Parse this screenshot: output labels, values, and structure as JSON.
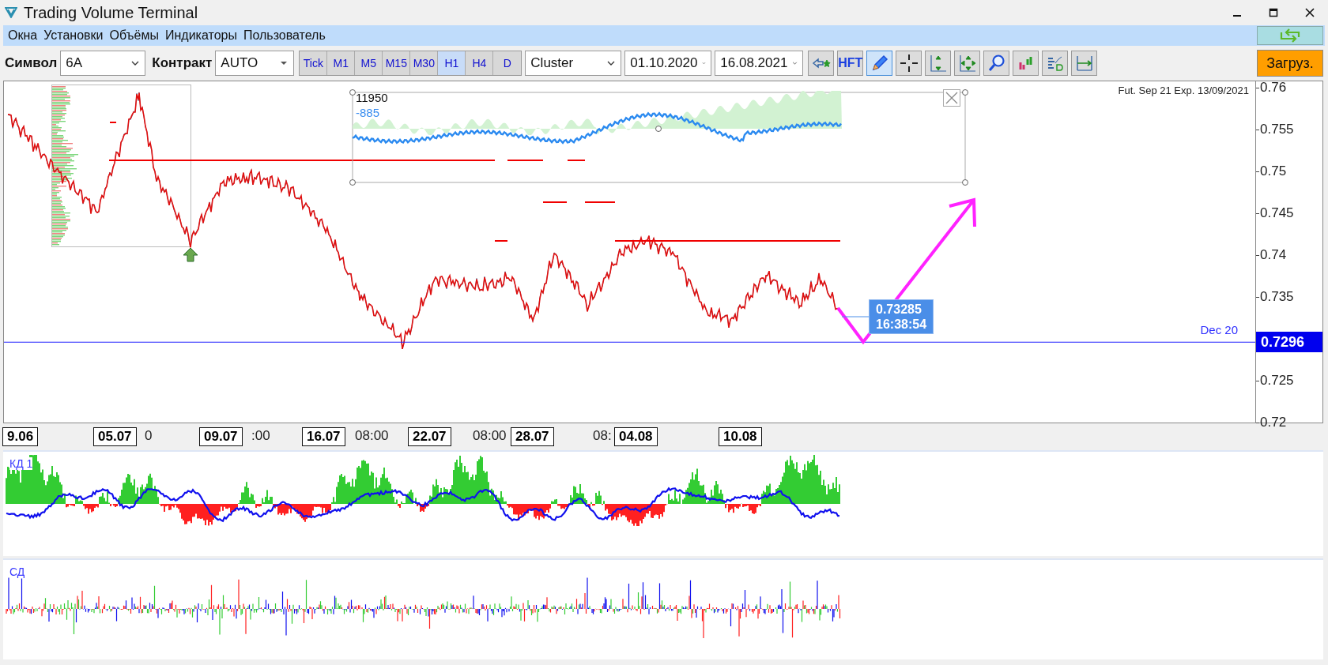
{
  "window": {
    "title": "Trading Volume Terminal"
  },
  "menu": [
    "Окна",
    "Установки",
    "Объёмы",
    "Индикаторы",
    "Пользователь"
  ],
  "toolbar": {
    "symbol_label": "Символ",
    "symbol": "6A",
    "contract_label": "Контракт",
    "contract": "AUTO",
    "timeframes": [
      {
        "label": "Tick",
        "selected": false
      },
      {
        "label": "M1",
        "selected": false
      },
      {
        "label": "M5",
        "selected": false
      },
      {
        "label": "M15",
        "selected": false
      },
      {
        "label": "M30",
        "selected": false
      },
      {
        "label": "H1",
        "selected": true
      },
      {
        "label": "H4",
        "selected": false
      },
      {
        "label": "D",
        "selected": false
      }
    ],
    "chart_type": "Cluster",
    "date_from": "01.10.2020",
    "date_to": "16.08.2021",
    "tools": [
      {
        "kind": "arrow-star",
        "selected": false
      },
      {
        "kind": "text",
        "label": "HFT",
        "selected": false
      },
      {
        "kind": "pencil",
        "selected": true
      },
      {
        "kind": "crosshair",
        "selected": false
      },
      {
        "kind": "fit-vertical",
        "selected": false
      },
      {
        "kind": "fit-all",
        "selected": false
      },
      {
        "kind": "search",
        "selected": false
      },
      {
        "kind": "bars",
        "selected": false
      },
      {
        "kind": "profile",
        "selected": false
      },
      {
        "kind": "range",
        "selected": false
      }
    ],
    "load_button": "Загруз."
  },
  "chart": {
    "contract_info": "Fut. Sep 21 Exp. 13/09/2021",
    "y_ticks": [
      "0.76",
      "0.755",
      "0.75",
      "0.745",
      "0.74",
      "0.735",
      "0.725",
      "0.72"
    ],
    "level_line": {
      "label": "Dec 20",
      "price": "0.7296"
    },
    "inset": {
      "volume": "11950",
      "delta": "-885"
    },
    "price_tag": {
      "price": "0.73285",
      "time": "16:38:54"
    },
    "x_labels": [
      {
        "text": "9.06",
        "boxed": true
      },
      {
        "text": "05.07",
        "boxed": true
      },
      {
        "text": "0",
        "boxed": false
      },
      {
        "text": "09.07",
        "boxed": true
      },
      {
        "text": ":00",
        "boxed": false
      },
      {
        "text": "16.07",
        "boxed": true
      },
      {
        "text": "08:00",
        "boxed": false
      },
      {
        "text": "22.07",
        "boxed": true
      },
      {
        "text": "08:00",
        "boxed": false
      },
      {
        "text": "28.07",
        "boxed": true
      },
      {
        "text": "08:",
        "boxed": false
      },
      {
        "text": "04.08",
        "boxed": true
      },
      {
        "text": "10.08",
        "boxed": true
      }
    ]
  },
  "panels": [
    {
      "kind": "cumulative-delta",
      "title": "КД 1"
    },
    {
      "kind": "delta",
      "title": "СД"
    }
  ]
}
